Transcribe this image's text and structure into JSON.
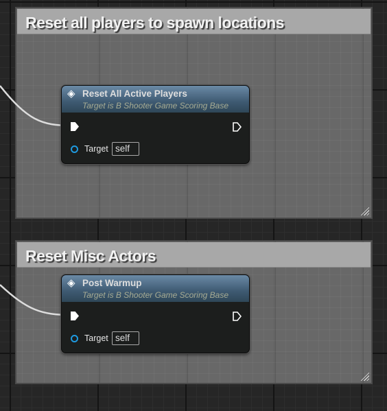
{
  "comments": [
    {
      "title": "Reset all players to spawn locations",
      "node": {
        "title": "Reset All Active Players",
        "subtitle": "Target is B Shooter Game Scoring Base",
        "pin_label": "Target",
        "pin_value": "self",
        "icon": "function-icon"
      }
    },
    {
      "title": "Reset Misc Actors",
      "node": {
        "title": "Post Warmup",
        "subtitle": "Target is B Shooter Game Scoring Base",
        "pin_label": "Target",
        "pin_value": "self",
        "icon": "function-icon"
      }
    }
  ],
  "colors": {
    "header": "#3e5a72",
    "target_pin": "#1e9ae0",
    "comment_bg": "#6e6e6e"
  }
}
